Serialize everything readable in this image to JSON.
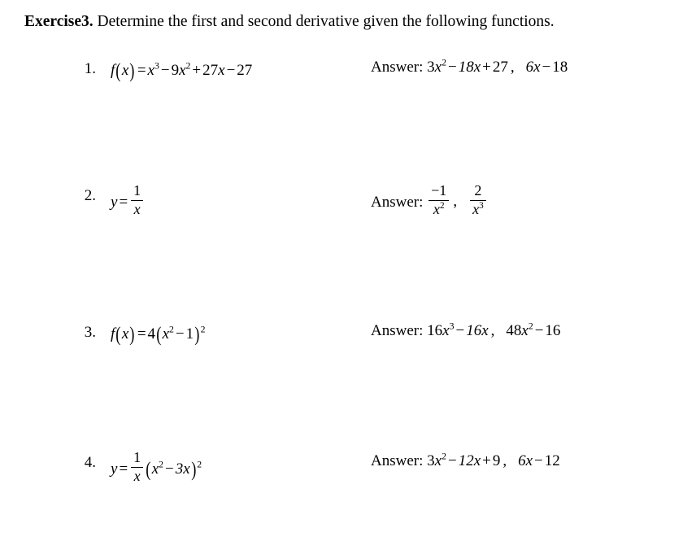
{
  "document": {
    "title_label": "Exercise3.",
    "instruction": "Determine the first and second derivative given the following functions.",
    "answer_label": "Answer:",
    "items": [
      {
        "number": "1.",
        "function": "f(x) = x³ − 9x² + 27x − 27",
        "first_derivative": "3x² − 18x + 27",
        "second_derivative": "6x − 18"
      },
      {
        "number": "2.",
        "function": "y = 1/x",
        "first_derivative": "−1/x²",
        "second_derivative": "2/x³"
      },
      {
        "number": "3.",
        "function": "f(x) = 4(x² − 1)²",
        "first_derivative": "16x³ − 16x",
        "second_derivative": "48x² − 16"
      },
      {
        "number": "4.",
        "function": "y = (1/x)(x² − 3x)²",
        "first_derivative": "3x² − 12x + 9",
        "second_derivative": "6x − 12"
      }
    ],
    "tokens": {
      "f_of": "f",
      "x": "x",
      "y": "y",
      "equals": "=",
      "minus": "−",
      "plus": "+",
      "comma": ",",
      "one": "1",
      "two": "2",
      "three": "3",
      "nine": "9",
      "twentyseven": "27",
      "eighteen": "18",
      "six": "6",
      "four": "4",
      "sixteen": "16",
      "fortyeight": "48",
      "twelve": "12",
      "neg_one": "−1",
      "exp2": "2",
      "exp3": "3",
      "paren_open": "(",
      "paren_close": ")",
      "three_x": "3x",
      "nine_x": "9x",
      "eighteen_x": "18x",
      "sixteen_x": "16x",
      "twelve_x": "12x",
      "six_x": "6x",
      "twentyseven_x": "27x",
      "fortyeight_x": "48x",
      "three_x_sq": "3x",
      "colon": ":"
    }
  }
}
